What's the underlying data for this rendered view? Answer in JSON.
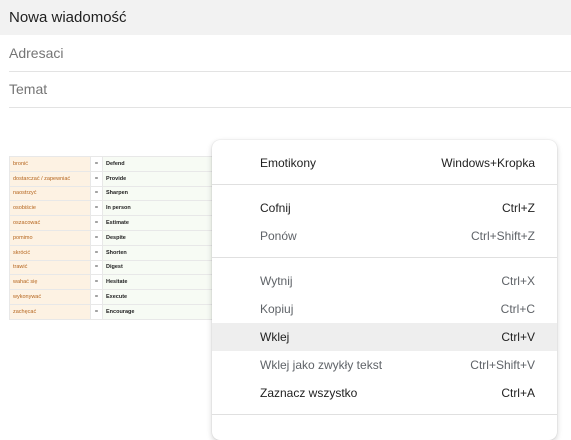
{
  "compose": {
    "title": "Nowa wiadomość",
    "to_placeholder": "Adresaci",
    "subject_placeholder": "Temat"
  },
  "vocab": [
    {
      "pl": "bronić",
      "en": "Defend"
    },
    {
      "pl": "dostarczać / zapewniać",
      "en": "Provide"
    },
    {
      "pl": "naostrzyć",
      "en": "Sharpen"
    },
    {
      "pl": "osobiście",
      "en": "In person"
    },
    {
      "pl": "oszacować",
      "en": "Estimate"
    },
    {
      "pl": "pomimo",
      "en": "Despite"
    },
    {
      "pl": "skrócić",
      "en": "Shorten"
    },
    {
      "pl": "trawić",
      "en": "Digest"
    },
    {
      "pl": "wahać się",
      "en": "Hesitate"
    },
    {
      "pl": "wykonywać",
      "en": "Execute"
    },
    {
      "pl": "zachęcać",
      "en": "Encourage"
    }
  ],
  "vocab_separator": "=",
  "context_menu": {
    "items": [
      {
        "label": "Emotikony",
        "shortcut": "Windows+Kropka"
      },
      {
        "label": "Cofnij",
        "shortcut": "Ctrl+Z"
      },
      {
        "label": "Ponów",
        "shortcut": "Ctrl+Shift+Z"
      },
      {
        "label": "Wytnij",
        "shortcut": "Ctrl+X"
      },
      {
        "label": "Kopiuj",
        "shortcut": "Ctrl+C"
      },
      {
        "label": "Wklej",
        "shortcut": "Ctrl+V"
      },
      {
        "label": "Wklej jako zwykły tekst",
        "shortcut": "Ctrl+Shift+V"
      },
      {
        "label": "Zaznacz wszystko",
        "shortcut": "Ctrl+A"
      }
    ]
  }
}
